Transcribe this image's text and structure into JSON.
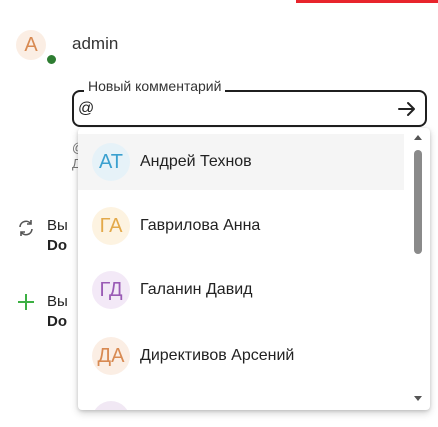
{
  "composer": {
    "avatar_letter": "A",
    "username": "admin",
    "field_label": "Новый комментарий",
    "input_value": "@",
    "hint_line_1": "@",
    "hint_line_2": "Д"
  },
  "activity": [
    {
      "icon": "refresh-icon",
      "action_text": "Вы",
      "doc_text": "Do"
    },
    {
      "icon": "plus-icon",
      "action_text": "Вы",
      "doc_text": "Do"
    }
  ],
  "mentions": {
    "items": [
      {
        "initials": "АТ",
        "name": "Андрей Технов",
        "avatar_bg": "#e6f2f8",
        "avatar_fg": "#3aa0cf"
      },
      {
        "initials": "ГА",
        "name": "Гаврилова Анна",
        "avatar_bg": "#fdf3e1",
        "avatar_fg": "#e3a94a"
      },
      {
        "initials": "ГД",
        "name": "Галанин Давид",
        "avatar_bg": "#f3e9f7",
        "avatar_fg": "#9a5bb5"
      },
      {
        "initials": "ДА",
        "name": "Директивов Арсений",
        "avatar_bg": "#fbeee4",
        "avatar_fg": "#d88a52"
      },
      {
        "initials": "",
        "name": "",
        "avatar_bg": "#f1e8f4",
        "avatar_fg": "#9a5bb5"
      }
    ]
  },
  "colors": {
    "accent_red": "#e8242c",
    "online_green": "#2e7d32",
    "plus_green": "#3cb043"
  }
}
